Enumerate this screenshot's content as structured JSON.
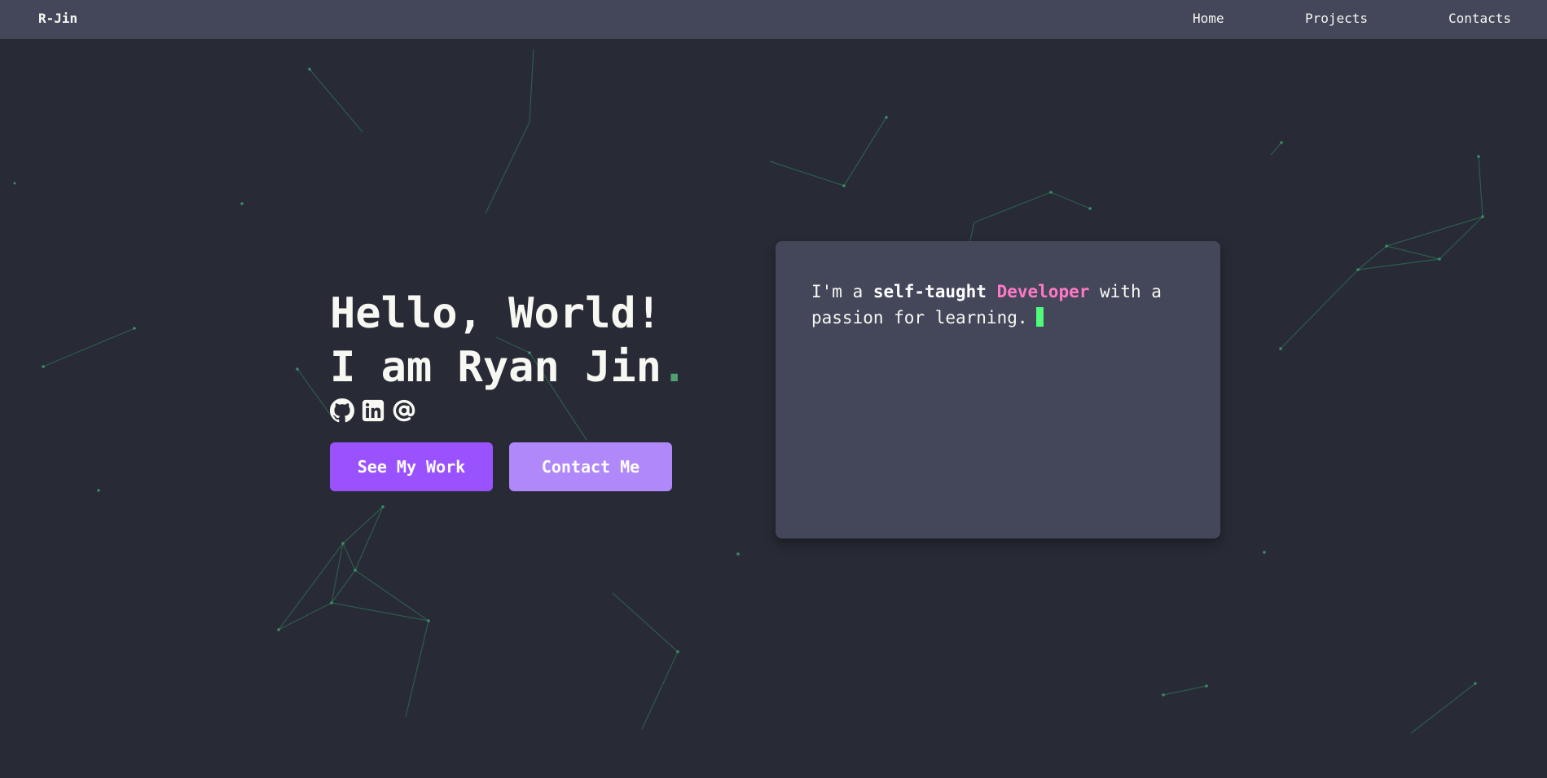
{
  "navbar": {
    "brand": "R-Jin",
    "links": [
      "Home",
      "Projects",
      "Contacts"
    ]
  },
  "hero": {
    "line1": "Hello, World!",
    "line2": "I am Ryan Jin",
    "accent": "."
  },
  "socials": [
    "github-icon",
    "linkedin-icon",
    "email-at-icon"
  ],
  "buttons": {
    "work": "See My Work",
    "contact": "Contact Me"
  },
  "terminal": {
    "prefix": "I'm a ",
    "bold": "self-taught",
    "highlight": "Developer",
    "suffix": " with a passion for learning."
  },
  "colors": {
    "background": "#282a36",
    "navbar": "#44475a",
    "accent_green": "#50fa7b",
    "purple_primary": "#9a52ff",
    "purple_secondary": "#b088f9",
    "pink": "#ff79c6"
  }
}
